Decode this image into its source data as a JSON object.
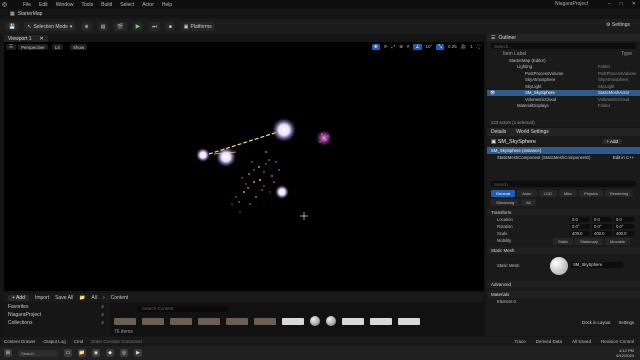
{
  "app": {
    "project_name": "NiagaraProject",
    "map_tab": "StarterMap",
    "menu": [
      "File",
      "Edit",
      "Window",
      "Tools",
      "Build",
      "Select",
      "Actor",
      "Help"
    ]
  },
  "toolbar": {
    "mode_label": "Selection Mode",
    "platforms_label": "Platforms",
    "settings_label": "Settings"
  },
  "viewport": {
    "tab_label": "Viewport 1",
    "perspective_label": "Perspective",
    "lit_label": "Lit",
    "show_label": "Show",
    "snap_angle": "10°",
    "scale_snap": "0.25",
    "camera_speed": "1"
  },
  "content": {
    "add_label": "+ Add",
    "import_label": "Import",
    "save_all_label": "Save All",
    "path_all": "All",
    "path_content": "Content",
    "favorites_label": "Favorites",
    "project_label": "NiagaraProject",
    "collections_label": "Collections",
    "search_placeholder": "Search Content",
    "items_count": "76 items"
  },
  "status": {
    "content_drawer": "Content Drawer",
    "output_log": "Output Log",
    "cmd": "Cmd",
    "cmd_placeholder": "Enter Console Command",
    "trace": "Trace",
    "derived_data": "Derived Data",
    "all_saved": "All Saved",
    "revision_control": "Revision Control"
  },
  "outliner": {
    "tab_label": "Outliner",
    "search_placeholder": "Search...",
    "col_label": "Item Label",
    "col_type": "Type",
    "rows": [
      {
        "label": "StarterMap (Editor)",
        "type": ""
      },
      {
        "label": "Lighting",
        "type": "Folder"
      },
      {
        "label": "PostProcessVolume",
        "type": "PostProcessVolume"
      },
      {
        "label": "SkyAtmosphere",
        "type": "SkyAtmosphere"
      },
      {
        "label": "SkyLight",
        "type": "SkyLight"
      },
      {
        "label": "SM_SkySphere",
        "type": "StaticMeshActor"
      },
      {
        "label": "VolumetricCloud",
        "type": "VolumetricCloud"
      },
      {
        "label": "MaterialDisplays",
        "type": "Folder"
      }
    ],
    "count": "223 actors (1 selected)"
  },
  "details": {
    "tab_details": "Details",
    "tab_world": "World Settings",
    "actor_name": "SM_SkySphere",
    "add_label": "+ Add",
    "instance_row": "SM_SkySphere (Instance)",
    "component_row": "StaticMeshComponent (StaticMeshComponent0)",
    "edit_in_cpp": "Edit in C++",
    "search_placeholder": "Search",
    "categories": [
      "General",
      "Actor",
      "LOD",
      "Misc",
      "Physics",
      "Rendering",
      "Streaming",
      "All"
    ],
    "transform_label": "Transform",
    "location_label": "Location",
    "rotation_label": "Rotation",
    "scale_label": "Scale",
    "location": [
      "0.0",
      "0.0",
      "0.0"
    ],
    "rotation": [
      "0.0°",
      "0.0°",
      "0.0°"
    ],
    "scale": [
      "400.0",
      "400.0",
      "400.0"
    ],
    "mobility_label": "Mobility",
    "mobility": [
      "Static",
      "Stationary",
      "Movable"
    ],
    "static_mesh_section": "Static Mesh",
    "static_mesh_label": "Static Mesh",
    "mesh_name": "SM_SkySphere",
    "advanced_label": "Advanced",
    "materials_label": "Materials",
    "element0_label": "Element 0",
    "dock_label": "Dock in Layout",
    "settings_label": "Settings"
  },
  "taskbar": {
    "search_placeholder": "Search",
    "time": "4:12 PM",
    "date": "6/12/2024"
  },
  "colors": {
    "accent": "#2f5b8c",
    "tab_active": "#1f5fb0",
    "particle": "#e070e0",
    "play_green": "#6fd16f"
  }
}
